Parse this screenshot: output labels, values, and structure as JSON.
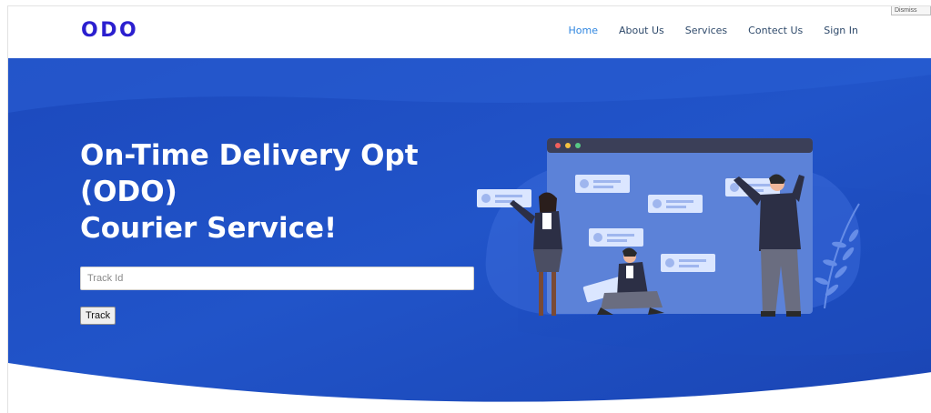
{
  "brand": {
    "logo_text": "ODO"
  },
  "nav": {
    "items": [
      {
        "label": "Home",
        "active": true
      },
      {
        "label": "About Us",
        "active": false
      },
      {
        "label": "Services",
        "active": false
      },
      {
        "label": "Contect Us",
        "active": false
      },
      {
        "label": "Sign In",
        "active": false
      }
    ]
  },
  "hero": {
    "title_line1": "On-Time Delivery Opt",
    "title_line2": "(ODO)",
    "title_line3": "Courier Service!",
    "track_input": {
      "placeholder": "Track Id",
      "value": ""
    },
    "track_button_label": "Track"
  },
  "corner_tag": "Dismiss",
  "colors": {
    "brand": "#2b1fcf",
    "nav_active": "#2f86e0",
    "nav_text": "#2f4a6b",
    "hero_primary": "#1f4fc4",
    "hero_dark": "#1840a8",
    "illustration_window": "#5a80d6",
    "illustration_bar": "#3b3f58"
  },
  "icons": [
    "profile-card-icon",
    "window-dots-icon",
    "leaf-plant-icon"
  ]
}
